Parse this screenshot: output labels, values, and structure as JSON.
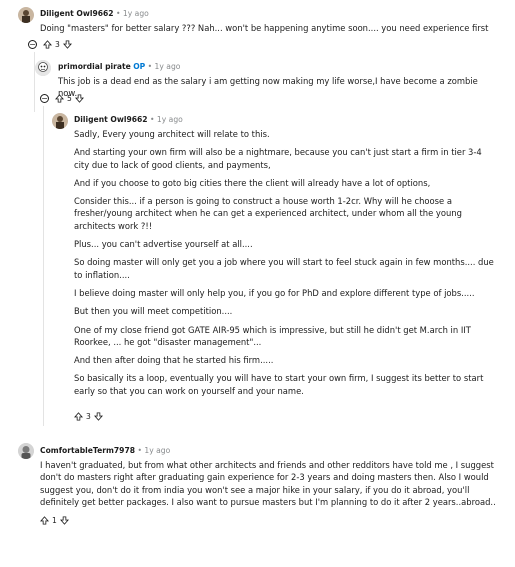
{
  "comments": [
    {
      "author": "Diligent Owl9662",
      "time": "1y ago",
      "paragraphs": [
        "Doing \"masters\" for better salary ??? Nah... won't be happening anytime soon.... you need experience first"
      ],
      "votes": "3"
    },
    {
      "author": "primordial pirate",
      "badge": "OP",
      "time": "1y ago",
      "paragraphs": [
        "This job is a dead end as the salary i am getting now making my life worse,I have become a zombie now."
      ],
      "votes": "5"
    },
    {
      "author": "Diligent Owl9662",
      "time": "1y ago",
      "paragraphs": [
        "Sadly, Every young architect will relate to this.",
        "And starting your own firm will also be a nightmare, because you can't just start a firm in tier 3-4 city due to lack of good clients, and payments,",
        "And if you choose to goto big cities there the client will already have a lot of options,",
        "Consider this... if a person is going to construct a house worth 1-2cr. Why will he choose a fresher/young architect when he can get a experienced architect, under whom all the young architects work ?!!",
        "Plus... you can't advertise yourself at all....",
        "So doing master will only get you a job where you will start to feel stuck again in few months.... due to inflation....",
        "I believe doing master will only help you, if you go for PhD and explore different type of jobs.....",
        "But then you will meet competition....",
        "One of my close friend got GATE AIR-95 which is impressive, but still he didn't get M.arch in IIT Roorkee, ... he got \"disaster management\"...",
        "And then after doing that he started his firm.....",
        "So basically its a loop, eventually you will have to start your own firm, I suggest its better to start early so that you can work on yourself and your name."
      ],
      "votes": "3"
    },
    {
      "author": "ComfortableTerm7978",
      "time": "1y ago",
      "paragraphs": [
        "I haven't graduated, but from what other architects and friends and other redditors have told me , I suggest don't do masters right after graduating gain experience for 2-3 years and doing masters then. Also I would suggest you, don't do it from india you won't see a major hike in your salary, if you do it abroad, you'll definitely get better packages. I also want to pursue masters but I'm planning to do it after 2 years..abroad.."
      ],
      "votes": "1"
    }
  ],
  "separator": "•",
  "collapse_symbol": "−",
  "colors": {
    "op_badge": "#0079d3",
    "meta_gray": "#878a8c",
    "thread_line": "#e3e3e3"
  }
}
